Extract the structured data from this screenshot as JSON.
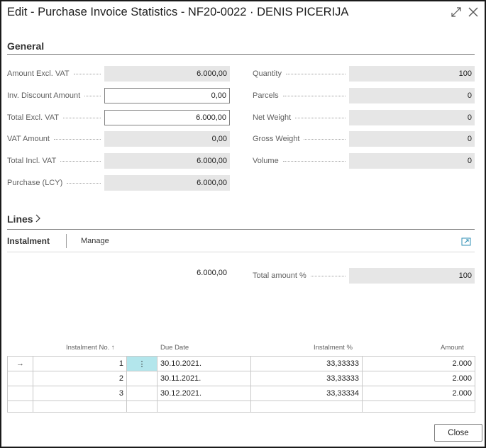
{
  "window": {
    "title": "Edit - Purchase Invoice Statistics - NF20-0022 · DENIS PICERIJA"
  },
  "general": {
    "heading": "General",
    "left_fields": [
      {
        "label": "Amount Excl. VAT",
        "value": "6.000,00",
        "editable": false
      },
      {
        "label": "Inv. Discount Amount",
        "value": "0,00",
        "editable": true
      },
      {
        "label": "Total Excl. VAT",
        "value": "6.000,00",
        "editable": true
      },
      {
        "label": "VAT Amount",
        "value": "0,00",
        "editable": false
      },
      {
        "label": "Total Incl. VAT",
        "value": "6.000,00",
        "editable": false
      },
      {
        "label": "Purchase (LCY)",
        "value": "6.000,00",
        "editable": false
      }
    ],
    "right_fields": [
      {
        "label": "Quantity",
        "value": "100"
      },
      {
        "label": "Parcels",
        "value": "0"
      },
      {
        "label": "Net Weight",
        "value": "0"
      },
      {
        "label": "Gross Weight",
        "value": "0"
      },
      {
        "label": "Volume",
        "value": "0"
      }
    ]
  },
  "lines": {
    "heading": "Lines",
    "tabs": {
      "instalment": "Instalment",
      "manage": "Manage"
    },
    "summary_amount": "6.000,00",
    "total_amount_label": "Total amount %",
    "total_amount_value": "100",
    "columns": {
      "instalment_no": "Instalment No.",
      "sort_indicator": "↑",
      "due_date": "Due Date",
      "instalment_pct": "Instalment %",
      "amount": "Amount"
    },
    "row_menu_glyph": "⋮",
    "current_row_glyph": "→",
    "rows": [
      {
        "no": "1",
        "due_date": "30.10.2021.",
        "pct": "33,33333",
        "amount": "2.000"
      },
      {
        "no": "2",
        "due_date": "30.11.2021.",
        "pct": "33,33333",
        "amount": "2.000"
      },
      {
        "no": "3",
        "due_date": "30.12.2021.",
        "pct": "33,33334",
        "amount": "2.000"
      }
    ]
  },
  "footer": {
    "close_label": "Close"
  },
  "icons": {
    "expand": "expand-icon",
    "close": "close-icon",
    "fact_box": "fact-box-icon"
  }
}
